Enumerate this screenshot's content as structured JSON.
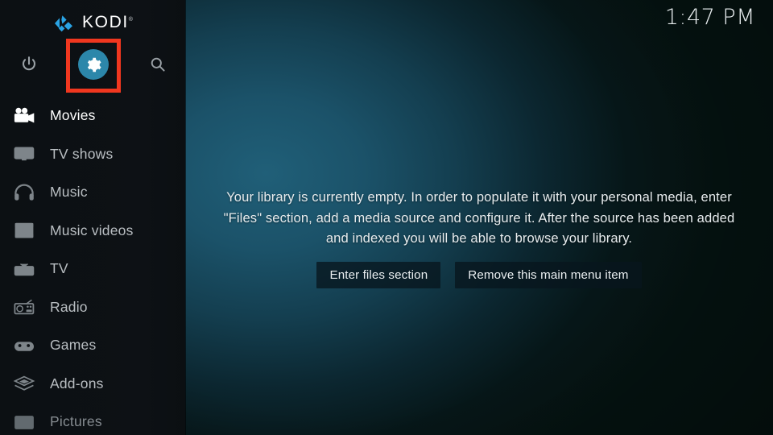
{
  "app": {
    "name": "KODI",
    "trademark": "®",
    "logo_color": "#2aa3e4"
  },
  "clock": {
    "time": "1:47 PM"
  },
  "sidebar": {
    "background_color": "#0d1115",
    "top_actions": [
      {
        "name": "power-icon",
        "label": "Power"
      },
      {
        "name": "settings-gear-icon",
        "label": "Settings",
        "highlighted": true,
        "circle_color": "#2c87aa",
        "highlight_color": "#f0371f"
      },
      {
        "name": "search-icon",
        "label": "Search"
      }
    ],
    "items": [
      {
        "label": "Movies",
        "icon": "movie-camera-icon",
        "state": "selected"
      },
      {
        "label": "TV shows",
        "icon": "monitor-icon",
        "state": "normal"
      },
      {
        "label": "Music",
        "icon": "headphones-icon",
        "state": "normal"
      },
      {
        "label": "Music videos",
        "icon": "music-film-icon",
        "state": "normal"
      },
      {
        "label": "TV",
        "icon": "television-icon",
        "state": "normal"
      },
      {
        "label": "Radio",
        "icon": "radio-icon",
        "state": "normal"
      },
      {
        "label": "Games",
        "icon": "gamepad-icon",
        "state": "normal"
      },
      {
        "label": "Add-ons",
        "icon": "addon-box-icon",
        "state": "normal"
      },
      {
        "label": "Pictures",
        "icon": "picture-icon",
        "state": "dim"
      }
    ]
  },
  "main": {
    "empty_message": "Your library is currently empty. In order to populate it with your personal media, enter \"Files\" section, add a media source and configure it. After the source has been added and indexed you will be able to browse your library.",
    "buttons": [
      {
        "label": "Enter files section"
      },
      {
        "label": "Remove this main menu item"
      }
    ]
  }
}
